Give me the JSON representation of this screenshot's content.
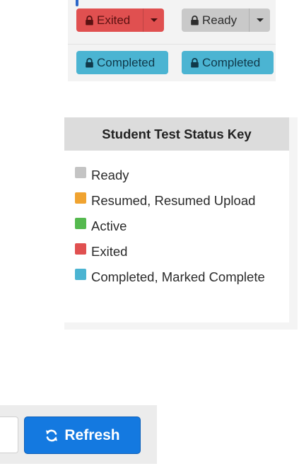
{
  "status_buttons": {
    "row1": [
      {
        "label": "Exited",
        "status": "exited",
        "icon": "lock-icon",
        "has_dropdown": true
      },
      {
        "label": "Ready",
        "status": "ready",
        "icon": "lock-icon",
        "has_dropdown": true
      }
    ],
    "row2": [
      {
        "label": "Completed",
        "status": "completed",
        "icon": "lock-icon",
        "has_dropdown": false
      },
      {
        "label": "Completed",
        "status": "completed",
        "icon": "lock-icon",
        "has_dropdown": false
      }
    ]
  },
  "status_key": {
    "title": "Student Test Status Key",
    "items": [
      {
        "label": "Ready",
        "color": "#c4c4c4"
      },
      {
        "label": "Resumed, Resumed Upload",
        "color": "#f0a330"
      },
      {
        "label": "Active",
        "color": "#55b94f"
      },
      {
        "label": "Exited",
        "color": "#e05050"
      },
      {
        "label": "Completed, Marked Complete",
        "color": "#4bb4d2"
      }
    ]
  },
  "refresh": {
    "label": "Refresh",
    "icon": "refresh-icon",
    "color": "#1479e0"
  }
}
